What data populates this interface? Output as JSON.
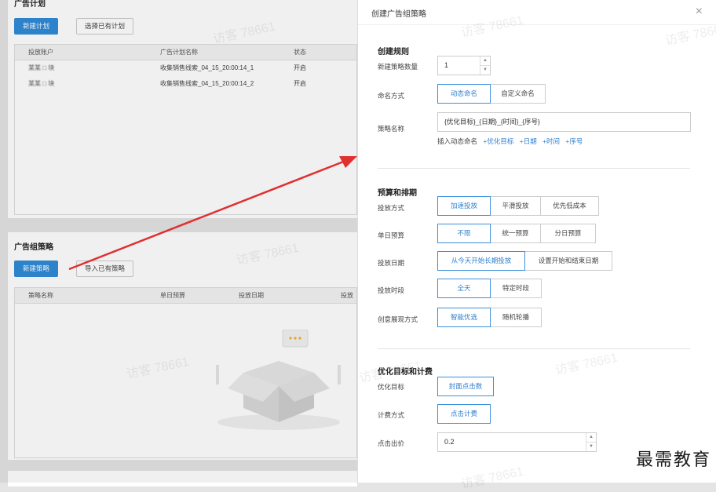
{
  "background": {
    "plan_card": {
      "title": "广告计划",
      "new_button": "新建计划",
      "select_button": "选择已有计划",
      "columns": [
        "投放账户",
        "广告计划名称",
        "状态"
      ],
      "rows": [
        {
          "account": "某某 □ 块",
          "name": "收集销售线索_04_15_20:00:14_1",
          "status": "开启"
        },
        {
          "account": "某某 □ 块",
          "name": "收集销售线索_04_15_20:00:14_2",
          "status": "开启"
        }
      ]
    },
    "strategy_card": {
      "title": "广告组策略",
      "new_button": "新建策略",
      "import_button": "导入已有策略",
      "columns": [
        "策略名称",
        "单日预算",
        "投放日期",
        "投放"
      ]
    }
  },
  "dialog": {
    "title": "创建广告组策略",
    "close": "×",
    "section_rules": {
      "title": "创建规则",
      "count_label": "新建策略数量",
      "count_value": "1",
      "naming_label": "命名方式",
      "naming_options": [
        "动态命名",
        "自定义命名"
      ],
      "naming_selected": 0,
      "name_label": "策略名称",
      "name_value": "{优化目标}_{日期}_{时间}_{序号}",
      "insert_label": "插入动态命名",
      "insert_links": [
        "+优化目标",
        "+日期",
        "+时间",
        "+序号"
      ]
    },
    "section_budget": {
      "title": "预算和排期",
      "delivery_label": "投放方式",
      "delivery_options": [
        "加速投放",
        "平滑投放",
        "优先低成本"
      ],
      "daily_label": "单日预算",
      "daily_options": [
        "不限",
        "统一预算",
        "分日预算"
      ],
      "date_label": "投放日期",
      "date_options": [
        "从今天开始长期投放",
        "设置开始和结束日期"
      ],
      "time_label": "投放时段",
      "time_options": [
        "全天",
        "特定时段"
      ],
      "creative_label": "创意展现方式",
      "creative_options": [
        "智能优选",
        "随机轮播"
      ]
    },
    "section_target": {
      "title": "优化目标和计费",
      "goal_label": "优化目标",
      "goal_option": "封面点击数",
      "billing_label": "计费方式",
      "billing_option": "点击计费",
      "bid_label": "点击出价",
      "bid_value": "0.2"
    }
  },
  "watermark_text": "访客 78661",
  "brand": "最需教育",
  "colors": {
    "accent": "#2f8bd8",
    "arrow": "#e03030"
  }
}
